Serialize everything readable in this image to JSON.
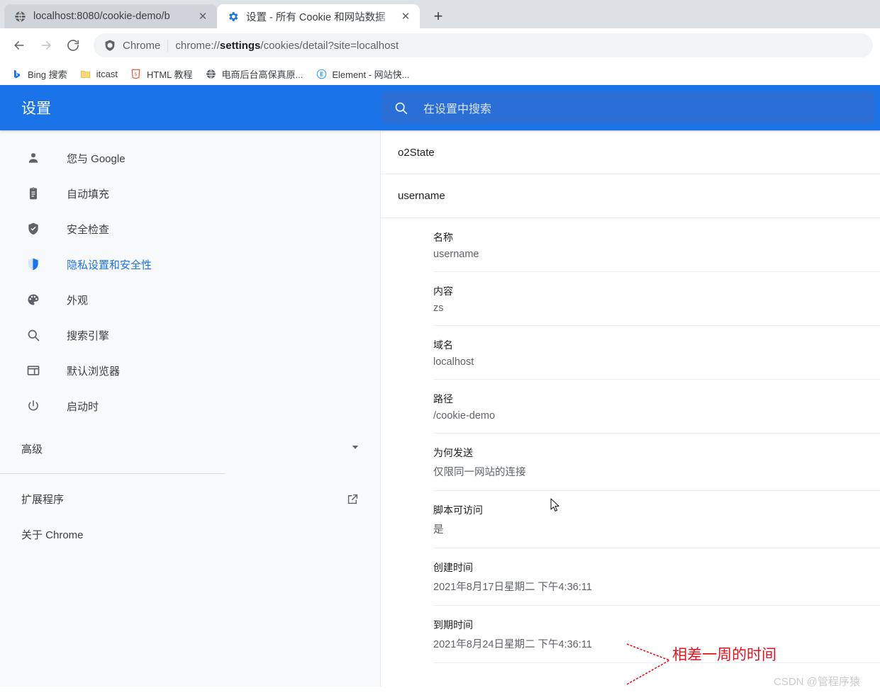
{
  "browser": {
    "tabs": [
      {
        "title": "localhost:8080/cookie-demo/b",
        "favicon": "globe-icon",
        "active": false,
        "close_label": "✕"
      },
      {
        "title": "设置 - 所有 Cookie 和网站数据",
        "favicon": "gear-icon",
        "active": true,
        "close_label": "✕"
      }
    ],
    "newtab_label": "+",
    "nav": {
      "back_label": "←",
      "forward_label": "→",
      "reload_label": "⟳"
    },
    "omnibox": {
      "chip": "Chrome",
      "url_prefix": "chrome://",
      "url_bold": "settings",
      "url_suffix": "/cookies/detail?site=localhost",
      "icon": "chrome-shield-icon"
    },
    "bookmarks": [
      {
        "label": "Bing 搜索",
        "icon": "bing-icon"
      },
      {
        "label": "itcast",
        "icon": "folder-icon"
      },
      {
        "label": "HTML 教程",
        "icon": "html5-icon"
      },
      {
        "label": "电商后台高保真原...",
        "icon": "globe-icon"
      },
      {
        "label": "Element - 网站快...",
        "icon": "element-icon"
      }
    ]
  },
  "settings": {
    "title": "设置",
    "search": {
      "placeholder": "在设置中搜索",
      "icon": "search-icon"
    },
    "sidebar": {
      "items": [
        {
          "label": "您与 Google",
          "icon": "person-icon",
          "selected": false
        },
        {
          "label": "自动填充",
          "icon": "clipboard-icon",
          "selected": false
        },
        {
          "label": "安全检查",
          "icon": "shield-check-icon",
          "selected": false
        },
        {
          "label": "隐私设置和安全性",
          "icon": "shield-icon",
          "selected": true
        },
        {
          "label": "外观",
          "icon": "palette-icon",
          "selected": false
        },
        {
          "label": "搜索引擎",
          "icon": "search-icon",
          "selected": false
        },
        {
          "label": "默认浏览器",
          "icon": "browser-window-icon",
          "selected": false
        },
        {
          "label": "启动时",
          "icon": "power-icon",
          "selected": false
        }
      ],
      "advanced": {
        "label": "高级",
        "icon": "chevron-down-icon"
      },
      "extensions": {
        "label": "扩展程序",
        "icon": "open-in-new-icon"
      },
      "about": {
        "label": "关于 Chrome"
      }
    },
    "content": {
      "sites": [
        {
          "name": "o2State"
        },
        {
          "name": "username"
        }
      ],
      "cookie_details": [
        {
          "label": "名称",
          "value": "username"
        },
        {
          "label": "内容",
          "value": "zs"
        },
        {
          "label": "域名",
          "value": "localhost"
        },
        {
          "label": "路径",
          "value": "/cookie-demo"
        },
        {
          "label": "为何发送",
          "value": "仅限同一网站的连接"
        },
        {
          "label": "脚本可访问",
          "value": "是"
        },
        {
          "label": "创建时间",
          "value": "2021年8月17日星期二 下午4:36:11"
        },
        {
          "label": "到期时间",
          "value": "2021年8月24日星期二 下午4:36:11"
        }
      ]
    }
  },
  "annotation": {
    "text": "相差一周的时间",
    "color": "#e8111f"
  },
  "watermark": {
    "text": "CSDN @管程序猿"
  },
  "colors": {
    "accent_blue": "#1a73e8",
    "search_blue": "#2b6fd6",
    "sidebar_bg": "#f8f9fa",
    "tab_strip_bg": "#dee1e6",
    "inactive_tab_bg": "#cfd4da"
  }
}
